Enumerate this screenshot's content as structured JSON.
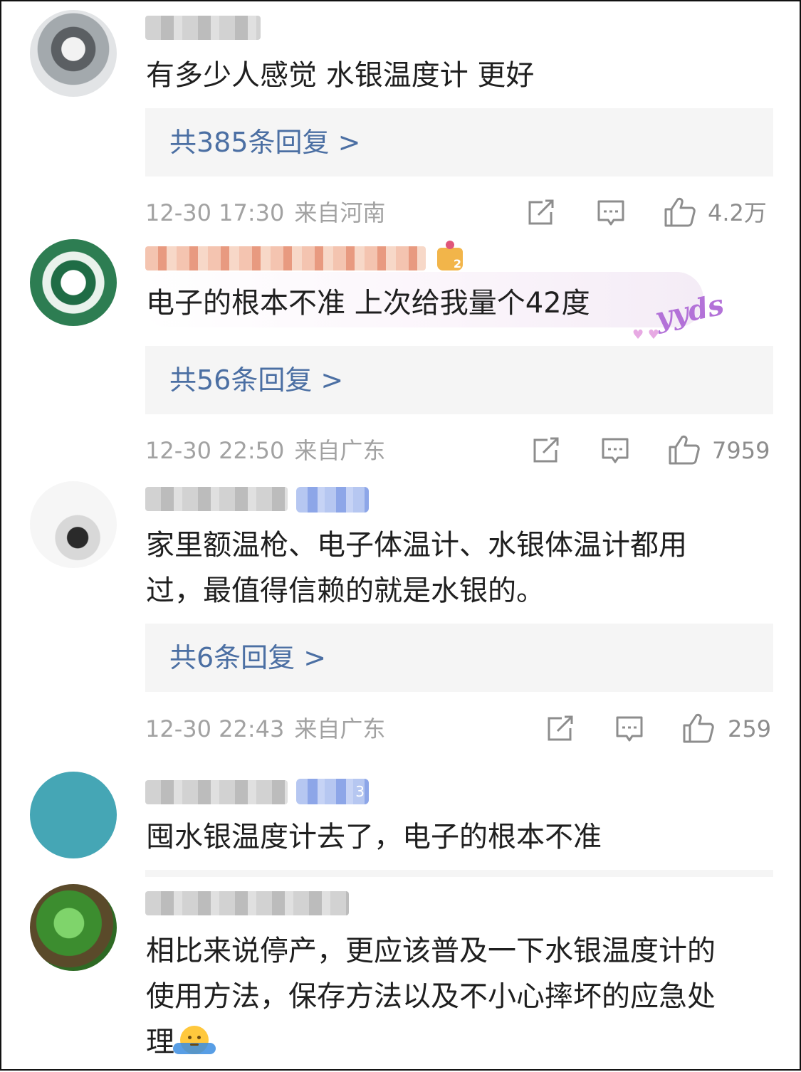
{
  "comments": [
    {
      "text_lines": [
        "有多少人感觉 水银温度计 更好"
      ],
      "replies_label": "共385条回复 >",
      "date": "12-30 17:30",
      "location": "来自河南",
      "likes": "4.2万"
    },
    {
      "text_lines": [
        "电子的根本不准 上次给我量个42度"
      ],
      "bubble_text": "yyds",
      "crown_level": "2",
      "replies_label": "共56条回复 >",
      "date": "12-30 22:50",
      "location": "来自广东",
      "likes": "7959"
    },
    {
      "text_lines": [
        "家里额温枪、电子体温计、水银体温计都用",
        "过，最值得信赖的就是水银的。"
      ],
      "replies_label": "共6条回复 >",
      "date": "12-30 22:43",
      "location": "来自广东",
      "likes": "259"
    },
    {
      "text_lines": [
        "囤水银温度计去了，电子的根本不准"
      ],
      "badge_level": "3"
    },
    {
      "text_lines": [
        "相比来说停产，更应该普及一下水银温度计的",
        "使用方法，保存方法以及不小心摔坏的应急处",
        "理"
      ]
    }
  ],
  "icons": {
    "share": "share-icon",
    "comment": "comment-icon",
    "like": "thumbs-up-icon"
  },
  "colors": {
    "reply_link": "#4b6fa3",
    "meta_text": "#a2a2a2",
    "reply_box_bg": "#f5f5f5"
  }
}
